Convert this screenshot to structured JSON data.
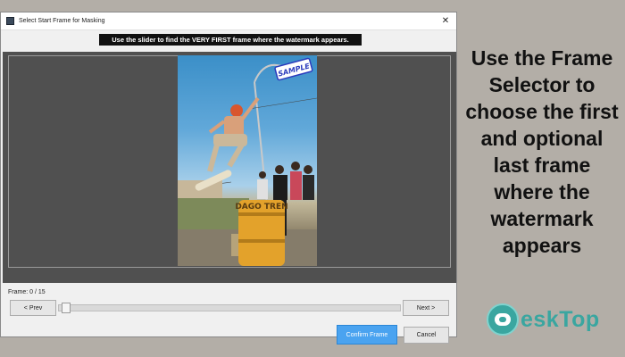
{
  "window": {
    "title": "Select Start Frame for Masking",
    "close_glyph": "✕"
  },
  "instruction": "Use the slider to find the VERY FIRST frame where the watermark appears.",
  "preview": {
    "watermark_text": "SAMPLE",
    "barrel_text": "DAGO TREN"
  },
  "frame": {
    "label": "Frame: 0 / 15",
    "current": 0,
    "total": 15
  },
  "buttons": {
    "prev": "< Prev",
    "next": "Next >",
    "confirm": "Confirm Frame",
    "cancel": "Cancel"
  },
  "side_caption": {
    "lines": [
      "Use the Frame",
      "Selector to",
      "choose the first",
      "and optional",
      "last frame",
      "where the",
      "watermark",
      "appears"
    ]
  },
  "logo": {
    "text": "eskTop",
    "icon": "desktop-logo-icon"
  },
  "colors": {
    "background": "#b3aea7",
    "accent": "#4aa3f0",
    "logo": "#3aa6a0"
  }
}
